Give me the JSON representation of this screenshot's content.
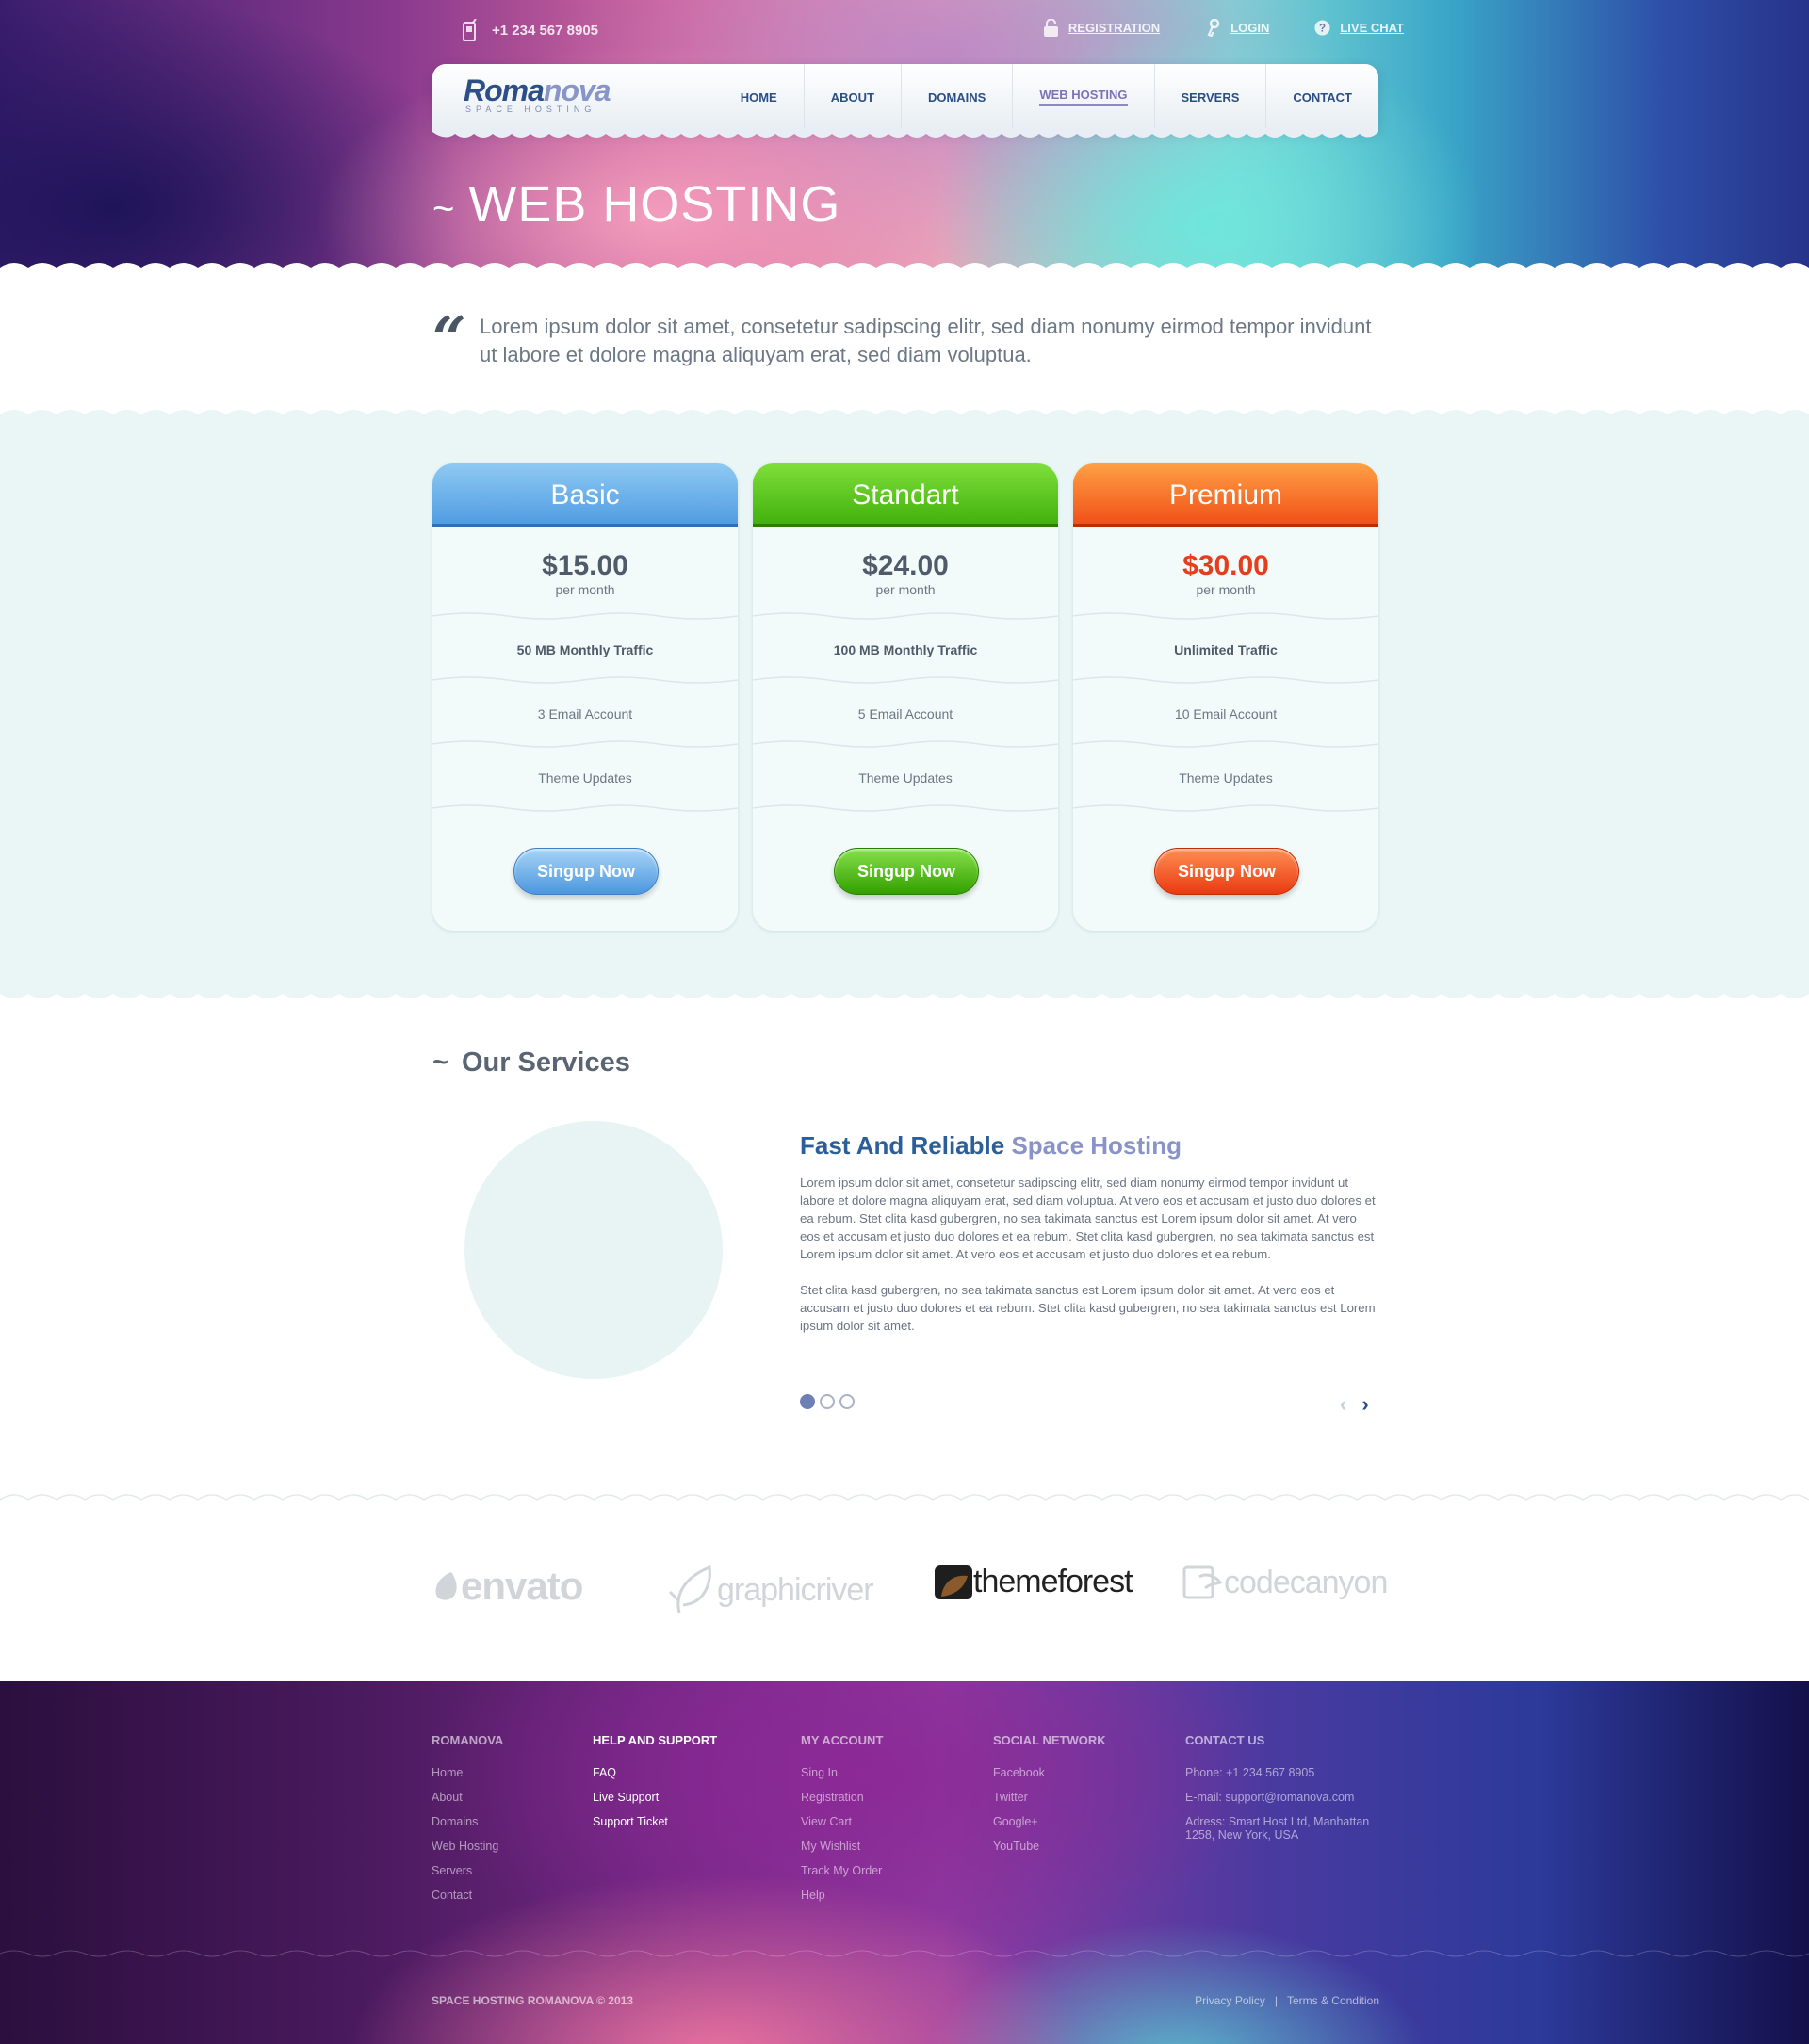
{
  "topbar": {
    "phone": "+1 234 567 8905",
    "links": [
      "REGISTRATION",
      "LOGIN",
      "LIVE CHAT"
    ]
  },
  "logo": {
    "name_main": "Roma",
    "name_accent": "nova",
    "tagline": "SPACE HOSTING"
  },
  "nav": {
    "items": [
      "HOME",
      "ABOUT",
      "DOMAINS",
      "WEB HOSTING",
      "SERVERS",
      "CONTACT"
    ],
    "active": "WEB HOSTING"
  },
  "page_title": "WEB HOSTING",
  "page_title_prefix": "~",
  "quote": "Lorem ipsum dolor sit amet, consetetur sadipscing elitr, sed diam nonumy eirmod tempor invidunt ut labore et dolore magna aliquyam erat, sed diam voluptua.",
  "plans": [
    {
      "name": "Basic",
      "price": "$15.00",
      "period": "per month",
      "traffic": "50 MB Monthly Traffic",
      "email": "3 Email Account",
      "updates": "Theme Updates",
      "button": "Singup Now",
      "color": "#4d9ae1"
    },
    {
      "name": "Standart",
      "price": "$24.00",
      "period": "per month",
      "traffic": "100 MB Monthly Traffic",
      "email": "5 Email Account",
      "updates": "Theme Updates",
      "button": "Singup Now",
      "color": "#3fae0a"
    },
    {
      "name": "Premium",
      "price": "$30.00",
      "period": "per month",
      "traffic": "Unlimited Traffic",
      "email": "10 Email Account",
      "updates": "Theme Updates",
      "button": "Singup Now",
      "color": "#ef4c15"
    }
  ],
  "services": {
    "title": "Our Services",
    "title_prefix": "~",
    "heading_main": "Fast And Reliable",
    "heading_accent": "Space Hosting",
    "paragraph1": "Lorem ipsum dolor sit amet, consetetur sadipscing elitr, sed diam nonumy eirmod tempor invidunt ut labore et dolore magna aliquyam erat, sed diam voluptua.  At vero eos et accusam et justo duo dolores et ea rebum. Stet clita kasd gubergren, no sea takimata sanctus est Lorem ipsum dolor sit amet. At vero eos et accusam et justo duo dolores et ea rebum. Stet clita kasd gubergren, no sea takimata sanctus est Lorem ipsum dolor sit amet. At vero eos et accusam et justo duo dolores et ea rebum.",
    "paragraph2": "Stet clita kasd gubergren, no sea takimata sanctus est Lorem ipsum dolor sit amet. At vero eos et accusam et justo duo dolores et ea rebum. Stet clita kasd gubergren, no sea takimata sanctus est Lorem ipsum dolor sit amet.",
    "slides": 3,
    "active_slide": 1,
    "prev_icon": "‹",
    "next_icon": "›"
  },
  "partners": [
    "envato",
    "graphicriver",
    "themeforest",
    "codecanyon"
  ],
  "footer": {
    "columns": [
      {
        "title": "ROMANOVA",
        "links": [
          "Home",
          "About",
          "Domains",
          "Web Hosting",
          "Servers",
          "Contact"
        ]
      },
      {
        "title": "HELP AND SUPPORT",
        "links": [
          "FAQ",
          "Live Support",
          "Support Ticket"
        ]
      },
      {
        "title": "MY ACCOUNT",
        "links": [
          "Sing In",
          "Registration",
          "View Cart",
          "My Wishlist",
          "Track My Order",
          "Help"
        ]
      },
      {
        "title": "SOCIAL NETWORK",
        "links": [
          "Facebook",
          "Twitter",
          "Google+",
          "YouTube"
        ]
      }
    ],
    "contact": {
      "title": "CONTACT US",
      "phone": "Phone: +1 234 567 8905",
      "email": "E-mail: support@romanova.com",
      "address_line1": "Adress: Smart Host Ltd, Manhattan",
      "address_line2": "1258, New York, USA"
    },
    "copyright": "SPACE HOSTING ROMANOVA © 2013",
    "bottom_links": [
      "Privacy Policy",
      "Terms & Condition"
    ],
    "bottom_separator": "|"
  }
}
